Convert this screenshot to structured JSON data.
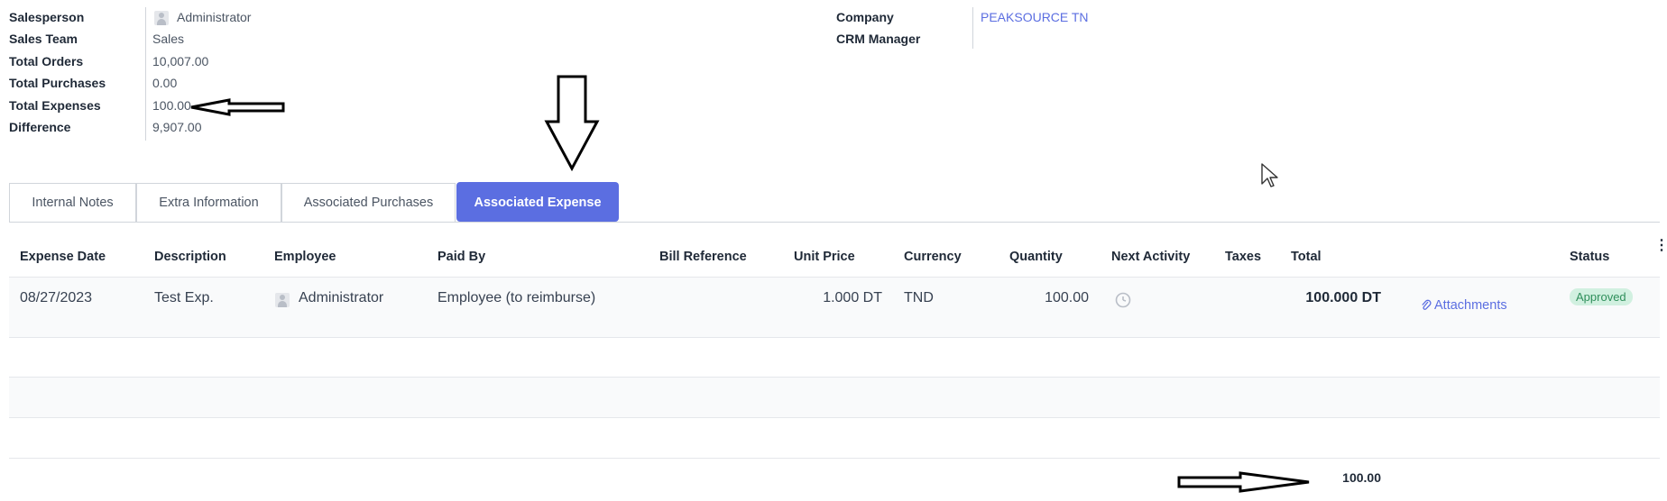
{
  "info_left": {
    "rows": [
      {
        "label": "Salesperson",
        "value": "Administrator"
      },
      {
        "label": "Sales Team",
        "value": "Sales"
      },
      {
        "label": "Total Orders",
        "value": "10,007.00"
      },
      {
        "label": "Total Purchases",
        "value": "0.00"
      },
      {
        "label": "Total Expenses",
        "value": "100.00"
      },
      {
        "label": "Difference",
        "value": "9,907.00"
      }
    ]
  },
  "info_right": {
    "company_label": "Company",
    "company_value": "PEAKSOURCE TN",
    "crm_label": "CRM Manager"
  },
  "tabs": [
    {
      "label": "Internal Notes"
    },
    {
      "label": "Extra Information"
    },
    {
      "label": "Associated Purchases"
    },
    {
      "label": "Associated Expense",
      "active": true
    }
  ],
  "table": {
    "columns": [
      "Expense Date",
      "Description",
      "Employee",
      "Paid By",
      "Bill Reference",
      "Unit Price",
      "Currency",
      "Quantity",
      "Next Activity",
      "Taxes",
      "Total",
      "Status"
    ],
    "row": {
      "expense_date": "08/27/2023",
      "description": "Test Exp.",
      "employee": "Administrator",
      "paid_by": "Employee (to reimburse)",
      "bill_reference": "",
      "unit_price": "1.000 DT",
      "currency": "TND",
      "quantity": "100.00",
      "taxes": "",
      "total": "100.000 DT",
      "attachments": "Attachments",
      "status": "Approved"
    },
    "footer_total": "100.00"
  },
  "colors": {
    "accent": "#5b6ee1",
    "link": "#5b6ee1",
    "status_bg": "#d1f0e0",
    "status_fg": "#2f8f5b"
  }
}
